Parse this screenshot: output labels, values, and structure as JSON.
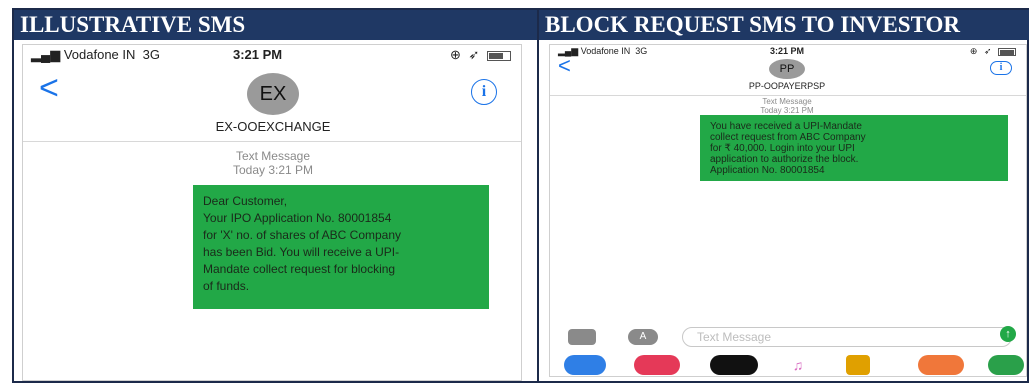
{
  "headers": {
    "left": "ILLUSTRATIVE SMS",
    "right": "BLOCK REQUEST SMS TO INVESTOR"
  },
  "left_phone": {
    "status": {
      "carrier": "Vodafone IN",
      "network": "3G",
      "time": "3:21 PM"
    },
    "back_label": "<",
    "info_label": "i",
    "avatar_initials": "EX",
    "contact_name": "EX-OOEXCHANGE",
    "message_type": "Text Message",
    "message_time": "Today 3:21 PM",
    "message_lines": [
      "Dear Customer,",
      "Your IPO Application No. 80001854",
      "for 'X' no. of shares of ABC Company",
      "has been Bid. You will receive a UPI-",
      "Mandate collect request for blocking",
      "of funds."
    ]
  },
  "right_phone": {
    "status": {
      "carrier": "Vodafone IN",
      "network": "3G",
      "time": "3:21 PM"
    },
    "back_label": "<",
    "info_label": "i",
    "avatar_initials": "PP",
    "contact_name": "PP-OOPAYERPSP",
    "message_type": "Text Message",
    "message_time": "Today 3:21 PM",
    "message_lines": [
      "You have received a UPI-Mandate",
      "collect request from ABC Company",
      "for ₹ 40,000. Login into your UPI",
      "application to authorize the block.",
      "Application No. 80001854"
    ],
    "input_placeholder": "Text Message",
    "app_colors": [
      "#2f7fe6",
      "#e53958",
      "#111111",
      "#d86bc0",
      "#e0a000",
      "#f0773a",
      "#2aa04a"
    ]
  },
  "colors": {
    "header_bg": "#1f3864",
    "bubble": "#22a847",
    "ios_blue": "#1a73e8"
  }
}
